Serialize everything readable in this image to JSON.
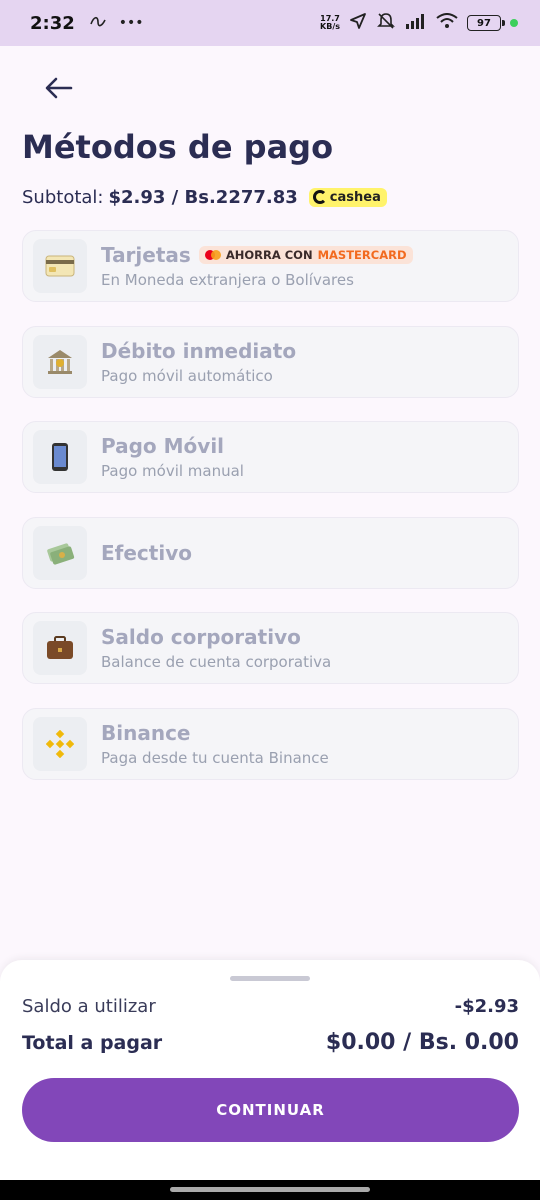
{
  "status_bar": {
    "time": "2:32",
    "net_speed_value": "17.7",
    "net_speed_unit": "KB/s",
    "battery": "97"
  },
  "header": {
    "back_icon": "arrow-left-icon",
    "title": "Métodos de pago"
  },
  "subtotal": {
    "label": "Subtotal:",
    "value": "$2.93 / Bs.2277.83",
    "badge": "cashea"
  },
  "methods": [
    {
      "name": "Tarjetas",
      "desc": "En Moneda extranjera o Bolívares",
      "icon": "credit-card-icon",
      "promo_prefix": "AHORRA CON",
      "promo_brand": "MASTERCARD"
    },
    {
      "name": "Débito inmediato",
      "desc": "Pago móvil automático",
      "icon": "bank-icon"
    },
    {
      "name": "Pago Móvil",
      "desc": "Pago móvil manual",
      "icon": "mobile-phone-icon"
    },
    {
      "name": "Efectivo",
      "desc": "",
      "icon": "cash-icon"
    },
    {
      "name": "Saldo corporativo",
      "desc": "Balance de cuenta corporativa",
      "icon": "briefcase-icon"
    },
    {
      "name": "Binance",
      "desc": "Paga desde tu cuenta Binance",
      "icon": "binance-icon"
    }
  ],
  "summary": {
    "balance_label": "Saldo a utilizar",
    "balance_value": "-$2.93",
    "total_label": "Total a pagar",
    "total_value": "$0.00 / Bs. 0.00",
    "continue_label": "CONTINUAR"
  },
  "colors": {
    "status_bar": "#e5d5f1",
    "background": "#fcf7fd",
    "primary": "#8247b9",
    "title_text": "#2b2d53",
    "method_text": "#a4a7bd"
  }
}
